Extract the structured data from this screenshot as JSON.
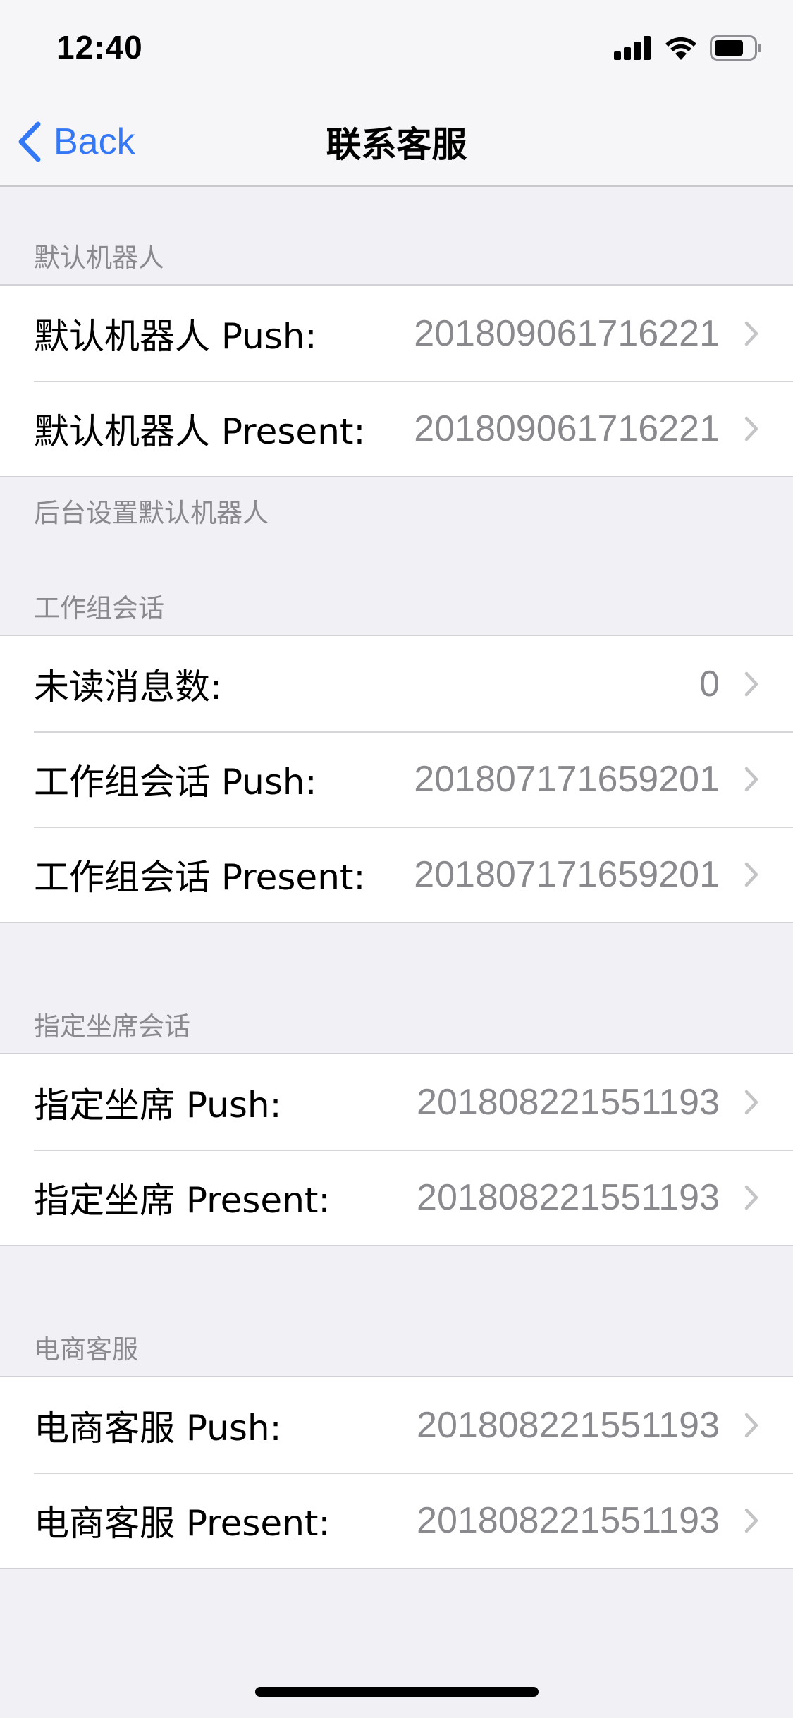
{
  "status_bar": {
    "time": "12:40"
  },
  "nav": {
    "back_label": "Back",
    "title": "联系客服"
  },
  "sections": [
    {
      "header": "默认机器人",
      "rows": [
        {
          "label": "默认机器人 Push:",
          "value": "201809061716221"
        },
        {
          "label": "默认机器人 Present:",
          "value": "201809061716221"
        }
      ],
      "footer": "后台设置默认机器人"
    },
    {
      "header": "工作组会话",
      "rows": [
        {
          "label": "未读消息数:",
          "value": "0"
        },
        {
          "label": "工作组会话 Push:",
          "value": "201807171659201"
        },
        {
          "label": "工作组会话 Present:",
          "value": "201807171659201"
        }
      ]
    },
    {
      "header": "指定坐席会话",
      "rows": [
        {
          "label": "指定坐席 Push:",
          "value": "201808221551193"
        },
        {
          "label": "指定坐席 Present:",
          "value": "201808221551193"
        }
      ]
    },
    {
      "header": "电商客服",
      "rows": [
        {
          "label": "电商客服 Push:",
          "value": "201808221551193"
        },
        {
          "label": "电商客服 Present:",
          "value": "201808221551193"
        }
      ]
    }
  ],
  "icons": {
    "back": "chevron-left-icon",
    "disclosure": "chevron-right-icon",
    "signal": "cellular-signal-icon",
    "wifi": "wifi-icon",
    "battery": "battery-icon"
  },
  "colors": {
    "accent": "#3478F6",
    "background": "#F0F0F5",
    "secondary_text": "#8A8A8E"
  }
}
